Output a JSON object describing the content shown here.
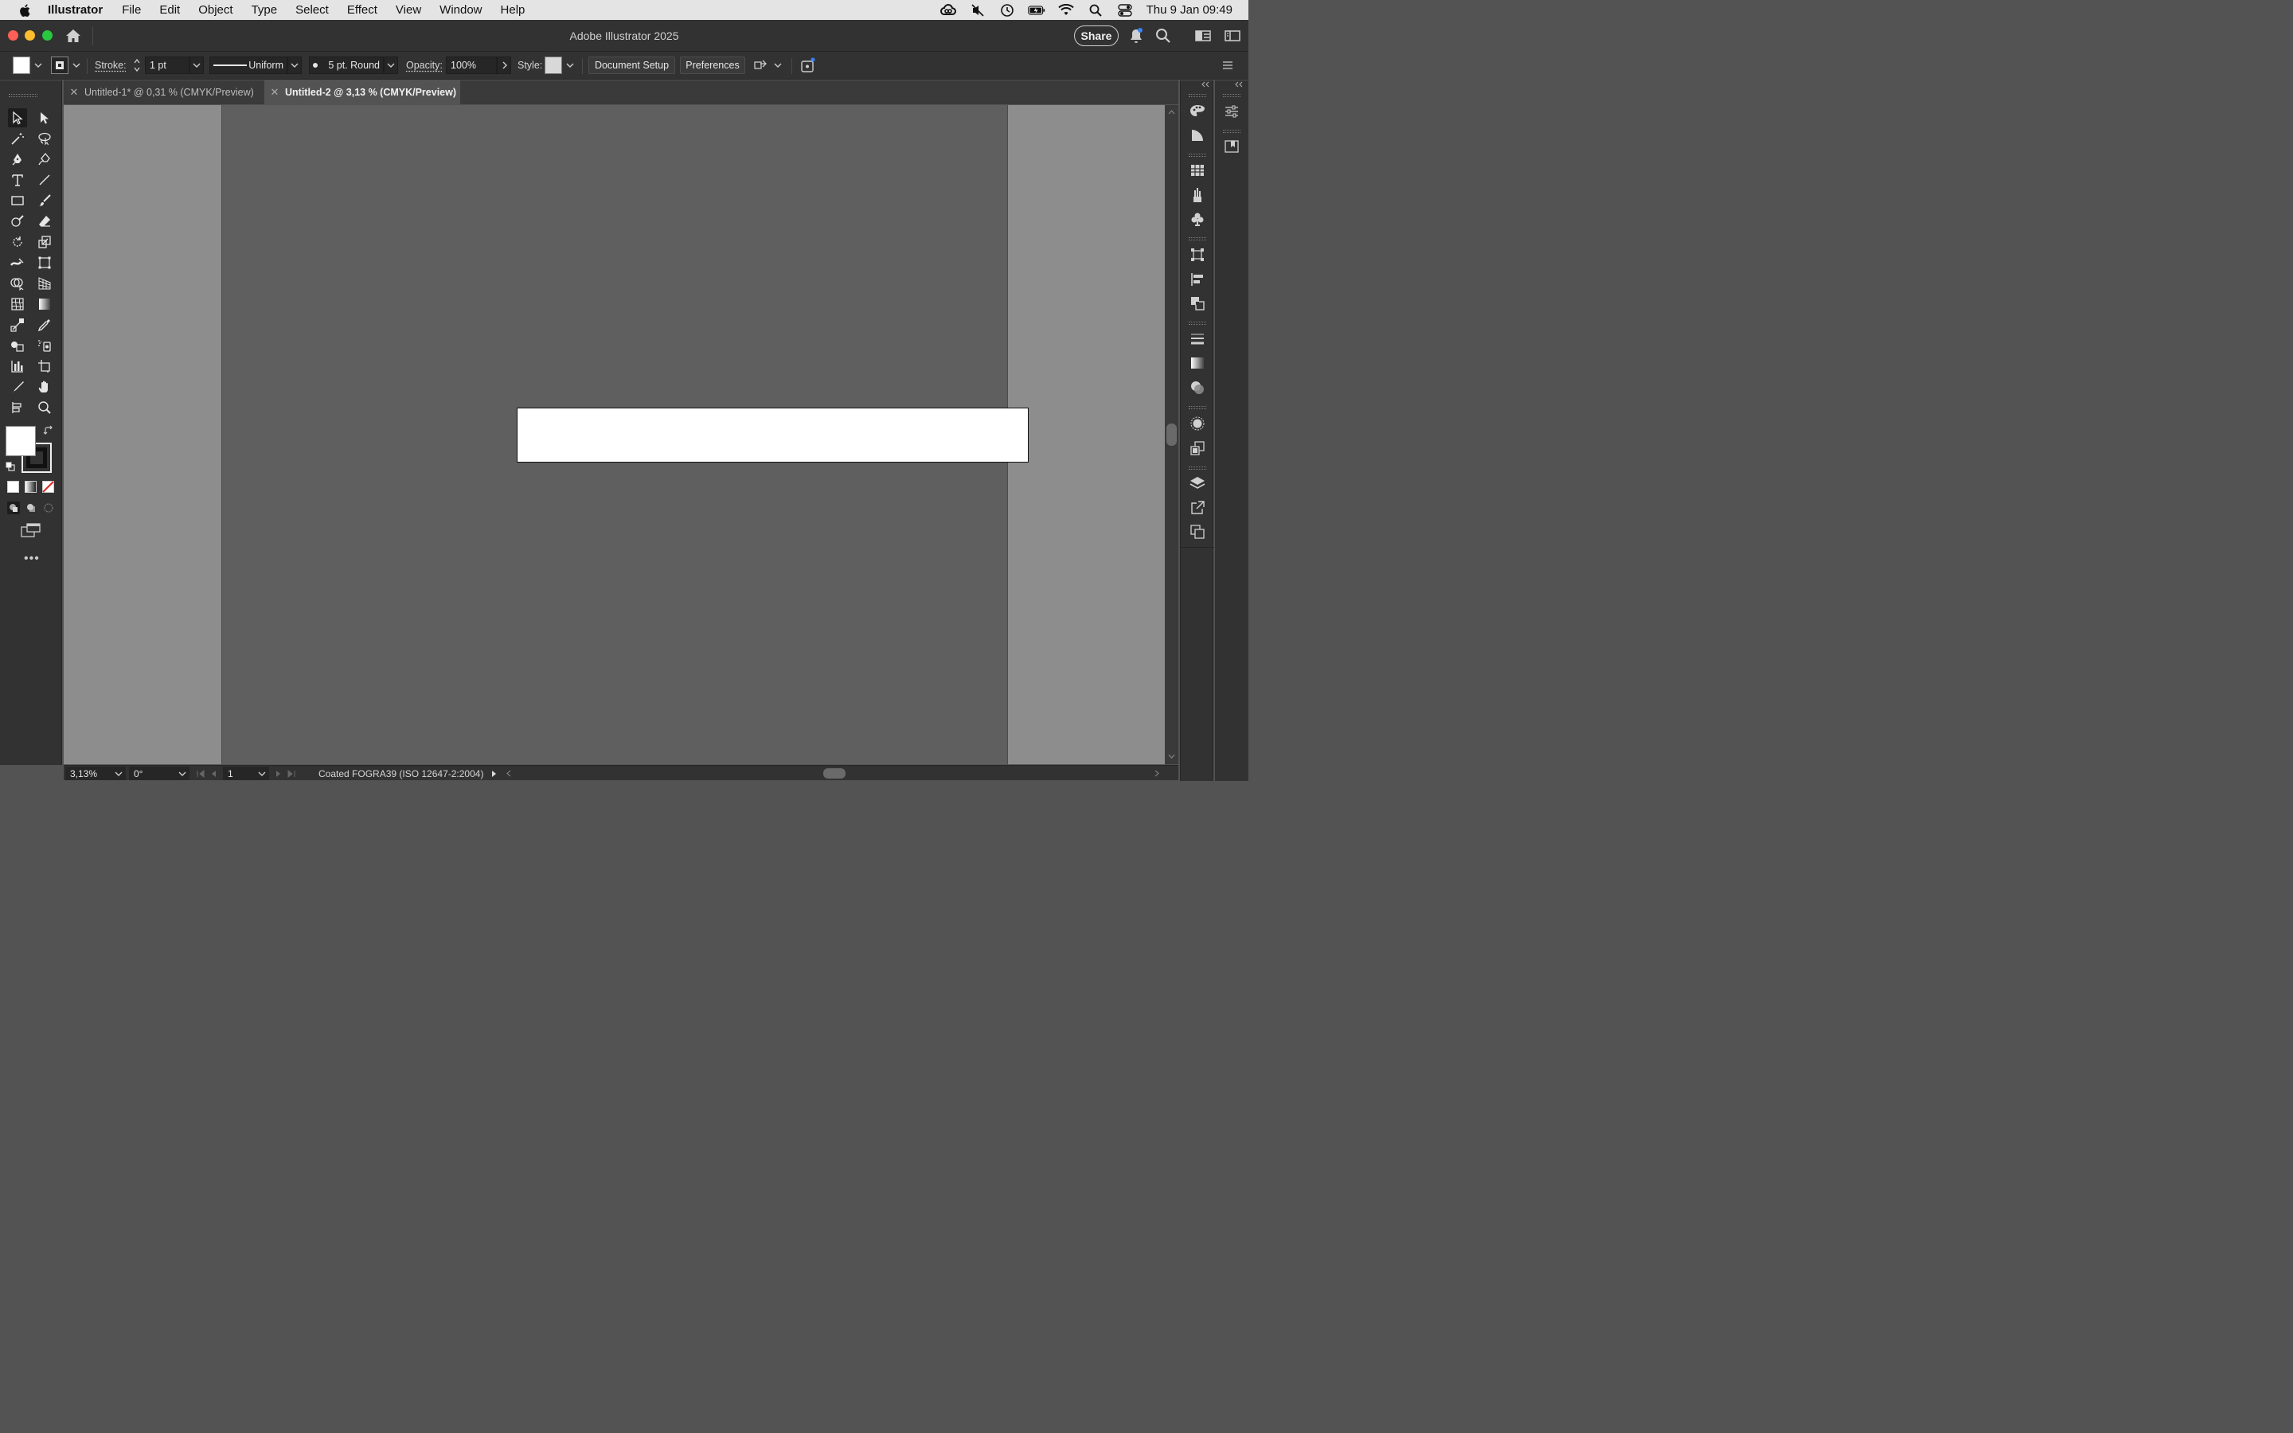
{
  "menubar": {
    "app_name": "Illustrator",
    "items": [
      "File",
      "Edit",
      "Object",
      "Type",
      "Select",
      "Effect",
      "View",
      "Window",
      "Help"
    ],
    "clock": "Thu 9 Jan  09:49"
  },
  "window": {
    "title": "Adobe Illustrator 2025",
    "share_label": "Share"
  },
  "control_bar": {
    "stroke_label": "Stroke:",
    "stroke_weight": "1 pt",
    "variable_width": "Uniform",
    "brush": "5 pt. Round",
    "opacity_label": "Opacity:",
    "opacity_value": "100%",
    "style_label": "Style:",
    "document_setup_label": "Document Setup",
    "preferences_label": "Preferences",
    "fill_color": "#ffffff",
    "stroke_color": "#000000"
  },
  "tabs": [
    {
      "label": "Untitled-1* @ 0,31 % (CMYK/Preview)",
      "active": false
    },
    {
      "label": "Untitled-2 @ 3,13 % (CMYK/Preview)",
      "active": true
    }
  ],
  "status_bar": {
    "zoom": "3,13%",
    "rotation": "0°",
    "artboard_number": "1",
    "color_profile": "Coated FOGRA39 (ISO 12647-2:2004)"
  },
  "colors": {
    "ui_dark": "#323232",
    "canvas_bg": "#8d8d8d",
    "artboard_bg": "#5f5f5f",
    "shape_fill": "#ffffff"
  }
}
